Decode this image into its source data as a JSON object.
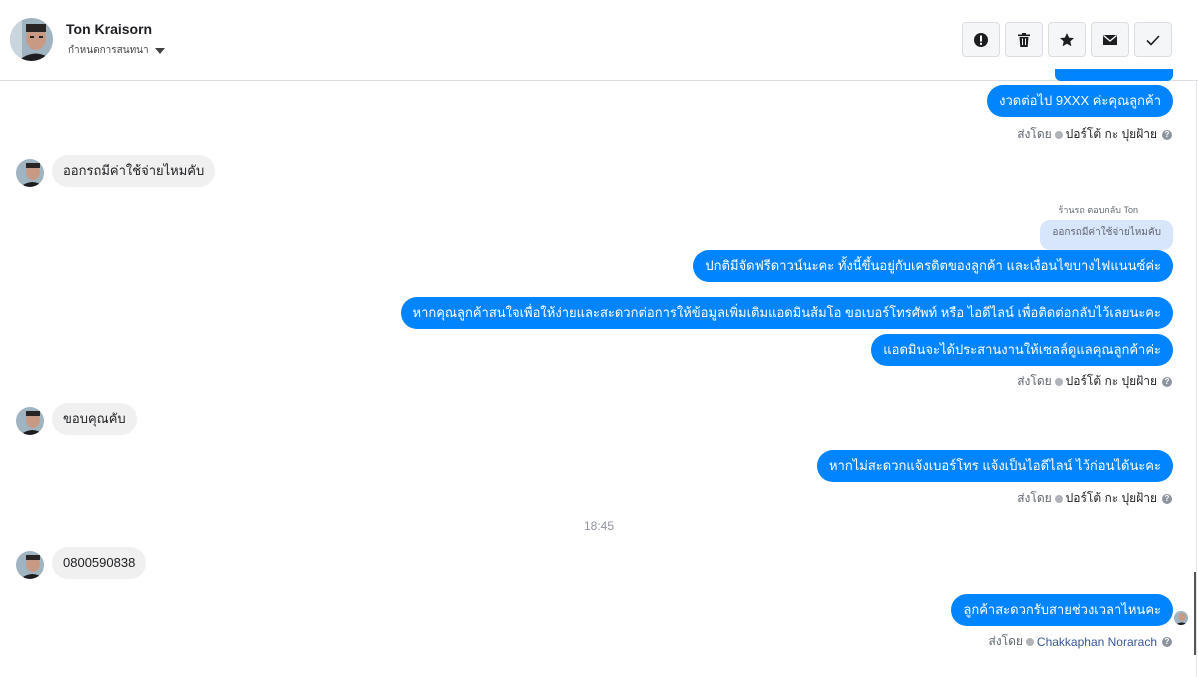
{
  "header": {
    "contact_name": "Ton Kraisorn",
    "subtitle": "กำหนดการสนทนา",
    "actions": [
      {
        "name": "report-button",
        "icon": "alert-icon"
      },
      {
        "name": "delete-button",
        "icon": "trash-icon"
      },
      {
        "name": "star-button",
        "icon": "star-icon"
      },
      {
        "name": "mark-unread-button",
        "icon": "envelope-icon"
      },
      {
        "name": "mark-done-button",
        "icon": "check-icon"
      }
    ]
  },
  "messages": {
    "m1": "งวดต่อไป 9XXX ค่ะคุณลูกค้า",
    "m1_sent_by_label": "ส่งโดย",
    "m1_agent": "ปอร์โต้ กะ ปุยฝ้าย",
    "m2": "ออกรถมีค่าใช้จ่ายไหมคับ",
    "reply_header": "ตอบกลับ Ton",
    "reply_header_prefix": "ร้านรถ",
    "reply_quote": "ออกรถมีค่าใช้จ่ายไหมคับ",
    "m3": "ปกติมีจัดฟรีดาวน์นะคะ ทั้งนี้ขึ้นอยู่กับเครดิตของลูกค้า และเงื่อนไขบางไฟแนนซ์ค่ะ",
    "m4": "หากคุณลูกค้าสนใจเพื่อให้ง่ายและสะดวกต่อการให้ข้อมูลเพิ่มเติมแอดมินส้มโอ ขอเบอร์โทรศัพท์ หรือ ไอดีไลน์ เพื่อติดต่อกลับไว้เลยนะคะ",
    "m5": "แอดมินจะได้ประสานงานให้เซลล์ดูแลคุณลูกค้าค่ะ",
    "m5_sent_by_label": "ส่งโดย",
    "m5_agent": "ปอร์โต้ กะ ปุยฝ้าย",
    "m6": "ขอบคุณคับ",
    "m7": "หากไม่สะดวกแจ้งเบอร์โทร แจ้งเป็นไอดีไลน์ ไว้ก่อนได้นะคะ",
    "m7_sent_by_label": "ส่งโดย",
    "m7_agent": "ปอร์โต้ กะ ปุยฝ้าย",
    "time_separator": "18:45",
    "m8": "0800590838",
    "m9": "ลูกค้าสะดวกรับสายช่วงเวลาไหนคะ",
    "m9_sent_by_label": "ส่งโดย",
    "m9_agent": "Chakkaphan Norarach",
    "help_glyph": "?"
  },
  "colors": {
    "outgoing_bubble": "#0084ff",
    "incoming_bubble": "#f0f0f0",
    "reply_quote_bg": "#d8e6fb"
  }
}
